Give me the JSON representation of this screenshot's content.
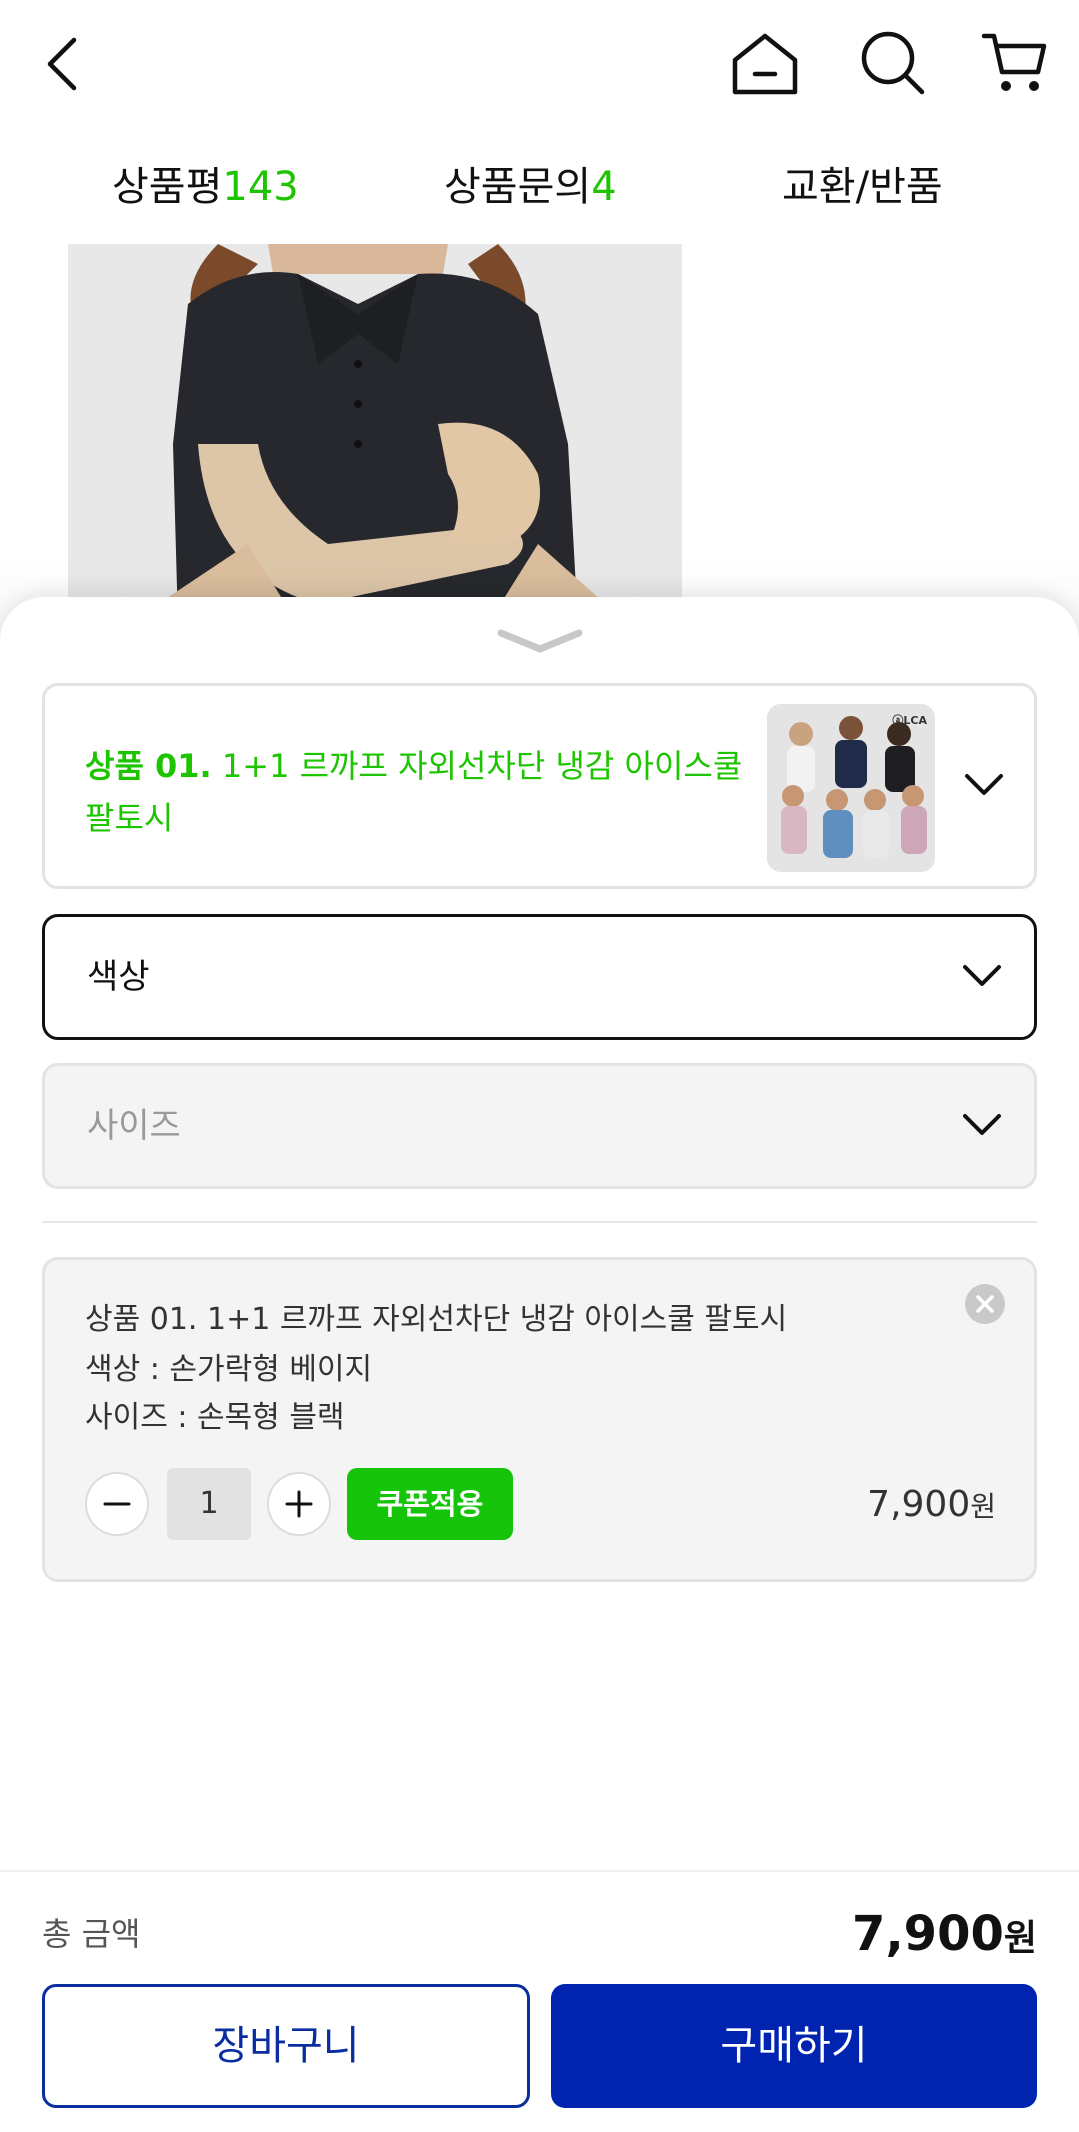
{
  "tabs": [
    {
      "label": "상품평",
      "count": "143"
    },
    {
      "label": "상품문의",
      "count": "4"
    },
    {
      "label": "교환/반품",
      "count": ""
    }
  ],
  "product": {
    "prefix": "상품 01.",
    "name": "1+1 르까프 자외선차단 냉감 아이스쿨 팔토시",
    "thumb_logo": "ⓐLCA"
  },
  "selects": {
    "color_label": "색상",
    "size_label": "사이즈"
  },
  "item": {
    "title": "상품 01. 1+1 르까프 자외선차단 냉감 아이스쿨 팔토시",
    "color": "색상  : 손가락형 베이지",
    "size": "사이즈  : 손목형 블랙",
    "quantity": "1",
    "coupon_label": "쿠폰적용",
    "price": "7,900",
    "currency": "원"
  },
  "footer": {
    "total_label": "총 금액",
    "total_value": "7,900",
    "currency": "원",
    "cart_label": "장바구니",
    "buy_label": "구매하기"
  },
  "colors": {
    "accent_green": "#1dc400",
    "brand_blue": "#0024b0"
  },
  "icons": [
    "back-icon",
    "home-icon",
    "search-icon",
    "cart-icon",
    "chevron-down-icon",
    "close-icon",
    "minus-icon",
    "plus-icon"
  ]
}
